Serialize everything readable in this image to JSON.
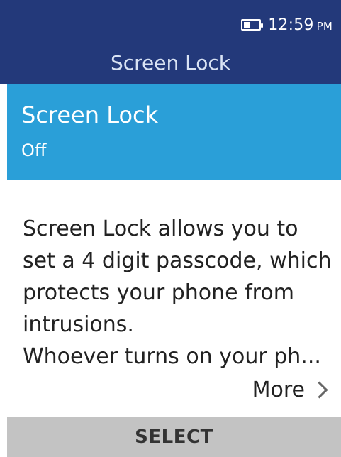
{
  "status_bar": {
    "battery_icon": "battery-icon",
    "time": "12:59",
    "ampm": "PM"
  },
  "header": {
    "title": "Screen Lock"
  },
  "list": {
    "items": [
      {
        "label": "Screen Lock",
        "value": "Off"
      }
    ]
  },
  "description": {
    "lines": [
      "Screen Lock allows you to",
      "set a 4 digit passcode, which",
      "protects your phone from",
      "intrusions.",
      "Whoever turns on your ph..."
    ]
  },
  "more": {
    "label": "More",
    "icon": "chevron-right-icon"
  },
  "softkey": {
    "center_label": "SELECT"
  },
  "colors": {
    "header_bg": "#23397a",
    "selected_bg": "#2a9fd8",
    "softkey_bg": "#c3c3c3"
  }
}
